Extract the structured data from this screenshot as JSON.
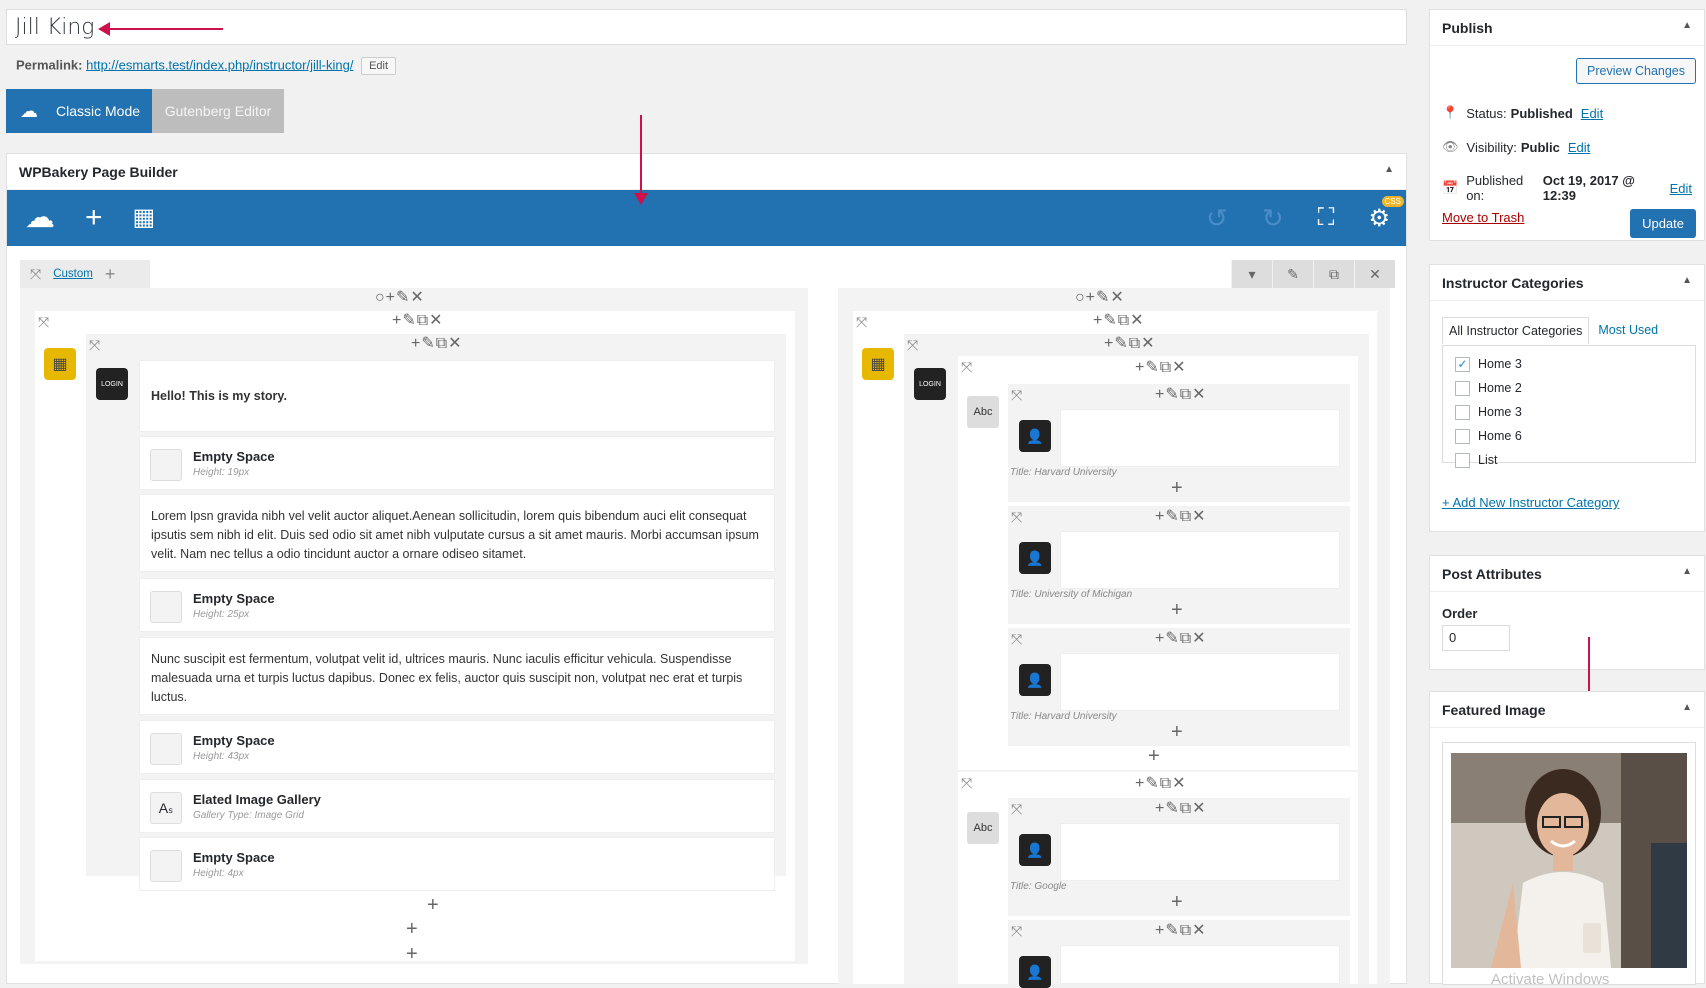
{
  "title": {
    "value": "Jill King"
  },
  "permalink": {
    "label": "Permalink:",
    "url": "http://esmarts.test/index.php/instructor/jill-king/",
    "edit": "Edit"
  },
  "modes": {
    "classic": "Classic Mode",
    "gutenberg": "Gutenberg Editor"
  },
  "builder": {
    "title": "WPBakery Page Builder",
    "css_badge": "CSS",
    "row_tab": "Custom",
    "left_elements": [
      {
        "type": "text",
        "text": "Hello! This is my story."
      },
      {
        "type": "space",
        "title": "Empty Space",
        "sub": "Height: 19px"
      },
      {
        "type": "text",
        "text": "Lorem Ipsn gravida nibh vel velit auctor aliquet.Aenean sollicitudin, lorem quis bibendum auci elit consequat ipsutis sem nibh id elit. Duis sed odio sit amet nibh vulputate cursus a sit amet mauris. Morbi accumsan ipsum velit. Nam nec tellus a odio tincidunt auctor a ornare odiseo sitamet."
      },
      {
        "type": "space",
        "title": "Empty Space",
        "sub": "Height: 25px"
      },
      {
        "type": "text",
        "text": "Nunc suscipit est fermentum, volutpat velit id, ultrices mauris. Nunc iaculis efficitur vehicula. Suspendisse malesuada urna et turpis luctus dapibus. Donec ex felis, auctor quis suscipit non, volutpat nec erat et turpis luctus."
      },
      {
        "type": "space",
        "title": "Empty Space",
        "sub": "Height: 43px"
      },
      {
        "type": "gallery",
        "title": "Elated Image Gallery",
        "sub": "Gallery Type: Image Grid"
      },
      {
        "type": "space",
        "title": "Empty Space",
        "sub": "Height: 4px"
      }
    ],
    "right_cards": [
      {
        "title": "Title: Harvard University"
      },
      {
        "title": "Title: University of Michigan"
      },
      {
        "title": "Title: Harvard University"
      },
      {
        "title": "Title: Google"
      }
    ],
    "abc": "Abc",
    "login_label": "LOGIN"
  },
  "publish": {
    "title": "Publish",
    "preview": "Preview Changes",
    "status_label": "Status:",
    "status_value": "Published",
    "status_edit": "Edit",
    "visibility_label": "Visibility:",
    "visibility_value": "Public",
    "visibility_edit": "Edit",
    "published_label": "Published on:",
    "published_value": "Oct 19, 2017 @ 12:39",
    "published_edit": "Edit",
    "trash": "Move to Trash",
    "update": "Update"
  },
  "categories": {
    "title": "Instructor Categories",
    "tab_all": "All Instructor Categories",
    "tab_used": "Most Used",
    "items": [
      {
        "label": "Home 3",
        "checked": true
      },
      {
        "label": "Home 2",
        "checked": false
      },
      {
        "label": "Home 3",
        "checked": false
      },
      {
        "label": "Home 6",
        "checked": false
      },
      {
        "label": "List",
        "checked": false
      }
    ],
    "add_new": "+ Add New Instructor Category"
  },
  "attributes": {
    "title": "Post Attributes",
    "order_label": "Order",
    "order_value": "0"
  },
  "featured": {
    "title": "Featured Image",
    "watermark": "Activate Windows"
  },
  "colors": {
    "accent": "#2271b1",
    "annotation_arrow": "#d0104c",
    "icon_yellow": "#e6b800"
  }
}
